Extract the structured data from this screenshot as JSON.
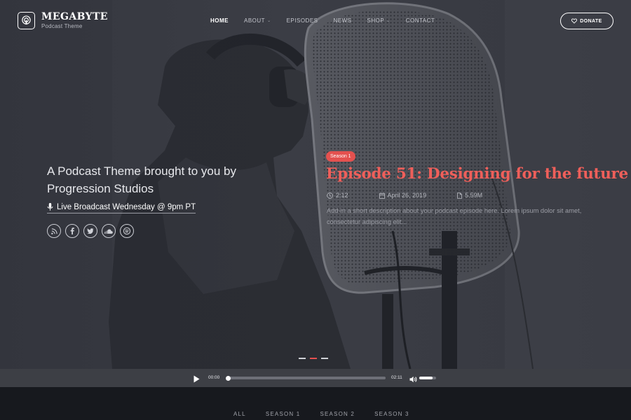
{
  "brand": {
    "title": "MEGABYTE",
    "subtitle": "Podcast Theme"
  },
  "nav": {
    "items": [
      {
        "label": "HOME",
        "active": true,
        "dropdown": false
      },
      {
        "label": "ABOUT",
        "active": false,
        "dropdown": true
      },
      {
        "label": "EPISODES",
        "active": false,
        "dropdown": false
      },
      {
        "label": "NEWS",
        "active": false,
        "dropdown": false
      },
      {
        "label": "SHOP",
        "active": false,
        "dropdown": true
      },
      {
        "label": "CONTACT",
        "active": false,
        "dropdown": false
      }
    ],
    "donate_label": "DONATE"
  },
  "hero": {
    "tagline": "A Podcast Theme brought to you by Progression Studios",
    "broadcast": "Live Broadcast Wednesday @ 9pm PT",
    "socials": [
      "rss-icon",
      "facebook-icon",
      "twitter-icon",
      "soundcloud-icon",
      "spotify-icon"
    ]
  },
  "episode": {
    "season_badge": "Season 1",
    "title": "Episode 51: Designing for the future",
    "duration": "2:12",
    "date": "April 26, 2019",
    "filesize": "5.59M",
    "description": "Add-in a short description about your podcast episode here. Lorem ipsum dolor sit amet, consectetur adipiscing elit..."
  },
  "slider": {
    "count": 3,
    "active_index": 1
  },
  "player": {
    "current_time": "00:00",
    "duration": "02:11",
    "progress": 0.0,
    "volume": 0.8
  },
  "filter": {
    "tabs": [
      "ALL",
      "SEASON 1",
      "SEASON 2",
      "SEASON 3"
    ]
  },
  "colors": {
    "accent": "#ef5f5a",
    "badge": "#e4514f",
    "player_bg": "#3d3f45",
    "page_bg": "#16181d"
  }
}
